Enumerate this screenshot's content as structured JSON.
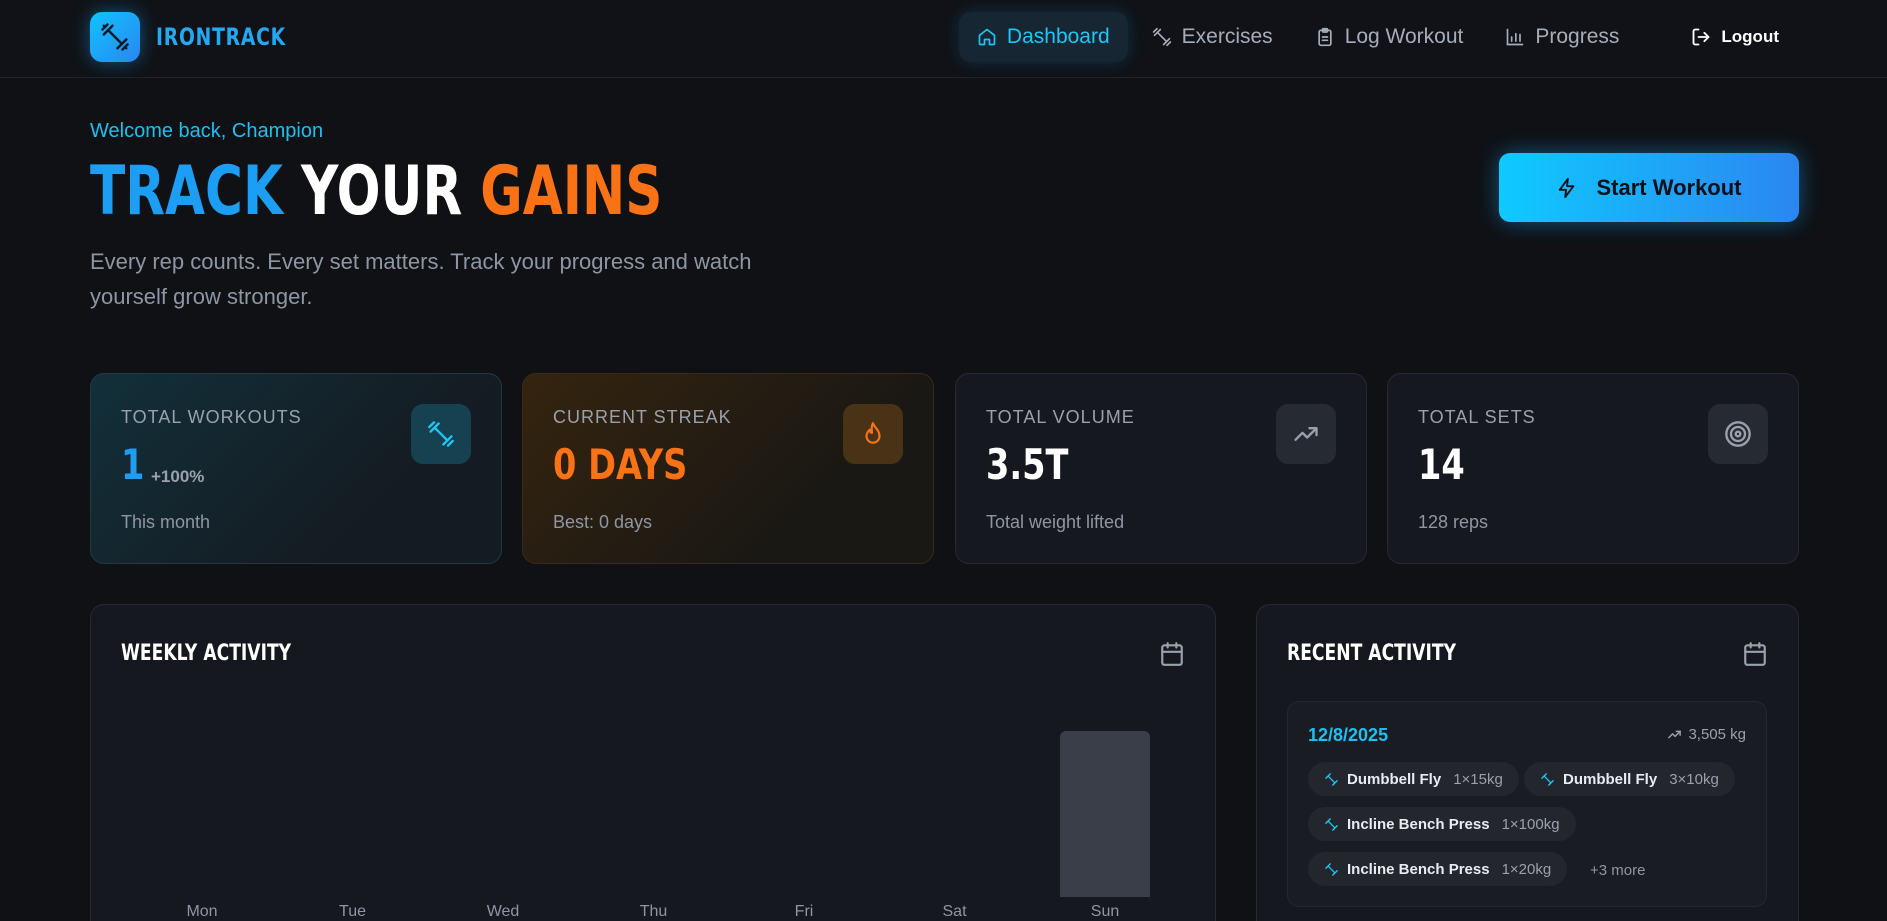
{
  "app": {
    "name": "IRONTRACK"
  },
  "nav": {
    "items": [
      {
        "label": "Dashboard",
        "icon": "home-icon",
        "active": true
      },
      {
        "label": "Exercises",
        "icon": "dumbbell-icon",
        "active": false
      },
      {
        "label": "Log Workout",
        "icon": "clipboard-icon",
        "active": false
      },
      {
        "label": "Progress",
        "icon": "bar-chart-icon",
        "active": false
      }
    ],
    "logout": "Logout"
  },
  "hero": {
    "welcome": "Welcome back, Champion",
    "title_parts": [
      "TRACK",
      "YOUR",
      "GAINS"
    ],
    "subtitle": "Every rep counts. Every set matters. Track your progress and watch yourself grow stronger.",
    "cta": "Start Workout"
  },
  "stats": [
    {
      "label": "TOTAL WORKOUTS",
      "value": "1",
      "delta": "+100%",
      "sub": "This month",
      "icon": "dumbbell-icon",
      "color": "#1c9ef4"
    },
    {
      "label": "CURRENT STREAK",
      "value": "0 DAYS",
      "sub": "Best: 0 days",
      "icon": "flame-icon",
      "color": "#f97316"
    },
    {
      "label": "TOTAL VOLUME",
      "value": "3.5T",
      "sub": "Total weight lifted",
      "icon": "trending-up-icon",
      "color": "#ffffff"
    },
    {
      "label": "TOTAL SETS",
      "value": "14",
      "sub": "128 reps",
      "icon": "target-icon",
      "color": "#ffffff"
    }
  ],
  "weekly": {
    "title": "WEEKLY ACTIVITY",
    "chart_data": {
      "type": "bar",
      "categories": [
        "Mon",
        "Tue",
        "Wed",
        "Thu",
        "Fri",
        "Sat",
        "Sun"
      ],
      "values": [
        0,
        0,
        0,
        0,
        0,
        0,
        1
      ],
      "ylim": [
        0,
        1.2
      ]
    }
  },
  "recent": {
    "title": "RECENT ACTIVITY",
    "entries": [
      {
        "date": "12/8/2025",
        "volume": "3,505 kg",
        "exercises": [
          {
            "name": "Dumbbell Fly",
            "sets": "1×15kg"
          },
          {
            "name": "Dumbbell Fly",
            "sets": "3×10kg"
          },
          {
            "name": "Incline Bench Press",
            "sets": "1×100kg"
          },
          {
            "name": "Incline Bench Press",
            "sets": "1×20kg"
          }
        ],
        "more": "+3 more"
      }
    ]
  },
  "colors": {
    "accent": "#1fbff2",
    "orange": "#f97316",
    "background": "#0f1115"
  }
}
